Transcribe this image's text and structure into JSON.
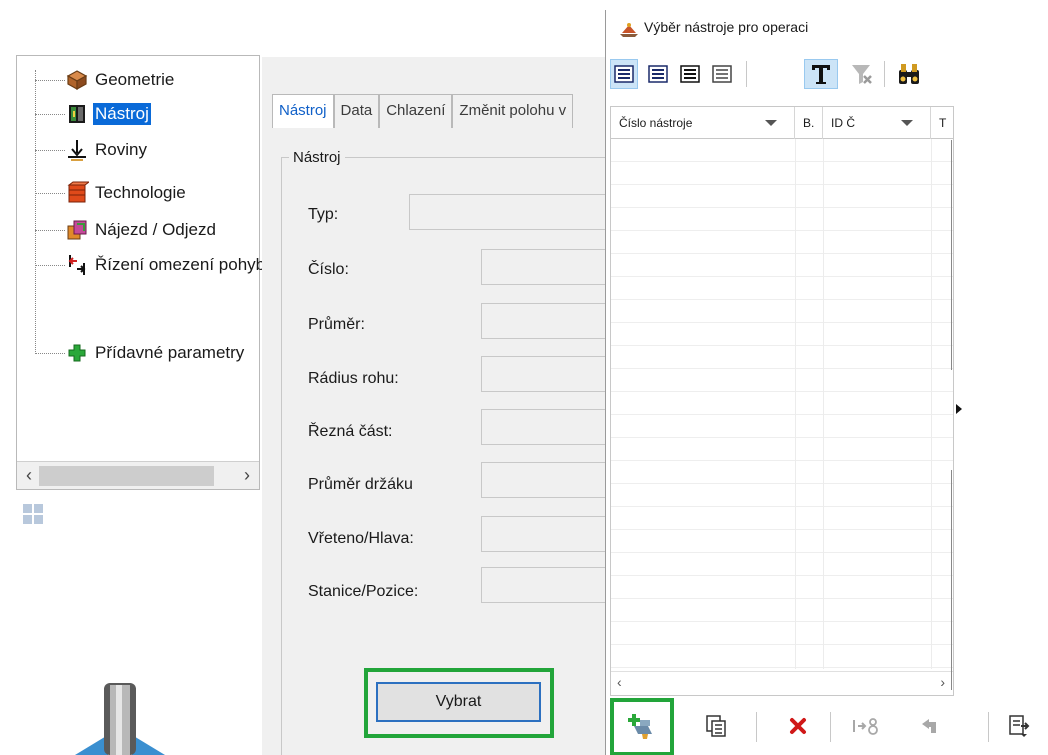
{
  "tree": {
    "items": [
      {
        "label": "Geometrie",
        "icon": "geometry-icon"
      },
      {
        "label": "Nástroj",
        "icon": "tool-icon",
        "selected": true
      },
      {
        "label": "Roviny",
        "icon": "planes-icon"
      },
      {
        "label": "Technologie",
        "icon": "technology-icon"
      },
      {
        "label": "Nájezd / Odjezd",
        "icon": "approach-retract-icon"
      },
      {
        "label": "Řízení omezení pohybu",
        "icon": "motion-limits-icon"
      },
      {
        "label": "Přídavné parametry",
        "icon": "plus-icon"
      }
    ],
    "scroll_left": "‹",
    "scroll_right": "›"
  },
  "properties": {
    "tabs": [
      "Nástroj",
      "Data",
      "Chlazení",
      "Změnit polohu v"
    ],
    "active_tab": 0,
    "group_title": "Nástroj",
    "fields": [
      {
        "label": "Typ:",
        "value": ""
      },
      {
        "label": "Číslo:",
        "value": ""
      },
      {
        "label": "Průměr:",
        "value": ""
      },
      {
        "label": "Rádius rohu:",
        "value": ""
      },
      {
        "label": "Řezná část:",
        "value": ""
      },
      {
        "label": "Průměr držáku",
        "value": ""
      },
      {
        "label": "Vřeteno/Hlava:",
        "value": ""
      },
      {
        "label": "Stanice/Pozice:",
        "value": ""
      }
    ],
    "select_button": "Vybrat"
  },
  "dialog": {
    "title": "Výběr nástroje pro operaci",
    "toolbar_icons": [
      "list-view-icon",
      "details-view-icon",
      "compact-view-icon",
      "small-list-icon",
      "text-filter-icon",
      "clear-filter-icon",
      "find-icon"
    ],
    "table": {
      "columns": [
        "Číslo nástroje",
        "B.",
        "ID Č",
        "T"
      ],
      "rows": []
    },
    "bottom_icons": [
      "add-tool-icon",
      "copy-icon",
      "delete-icon",
      "renumber-icon",
      "back-icon",
      "export-icon"
    ],
    "table_scroll_left": "‹",
    "table_scroll_right": "›"
  },
  "colors": {
    "highlight": "#22a53a",
    "selection": "#0a6ad8",
    "accent_link": "#1060c8"
  }
}
